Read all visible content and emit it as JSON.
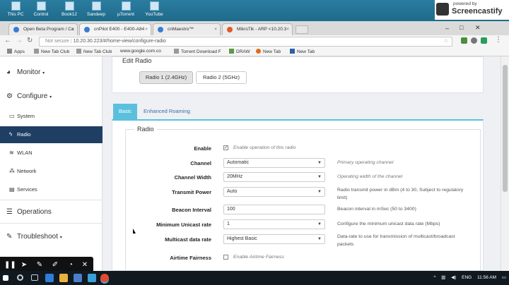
{
  "desktop": {
    "icons": [
      "This PC",
      "Control",
      "Book12",
      "Sandeep",
      "µTorrent",
      "YouTube"
    ],
    "watermark": {
      "powered_by": "powered by",
      "brand": "Screencastify"
    }
  },
  "browser": {
    "tabs": [
      {
        "label": "Open Beta Program / Ca",
        "active": false
      },
      {
        "label": "cnPilot E400 - E400-A84",
        "active": true
      },
      {
        "label": "cnMaestro™",
        "active": false
      },
      {
        "label": "MikroTik - ARP <10.20.3",
        "active": false
      }
    ],
    "security": "Not secure",
    "url": "10.20.30.223/#/home-view/configure-radio",
    "bookmarks": [
      "Apps",
      "New Tab Club",
      "New Tab Club",
      "www.google.com.co",
      "Torrent Download F",
      "DRAW",
      "New Tab",
      "New Tab"
    ]
  },
  "sidebar": {
    "monitor": "Monitor",
    "configure": "Configure",
    "items": [
      {
        "label": "System",
        "active": false
      },
      {
        "label": "Radio",
        "active": true
      },
      {
        "label": "WLAN",
        "active": false
      },
      {
        "label": "Network",
        "active": false
      },
      {
        "label": "Services",
        "active": false
      }
    ],
    "operations": "Operations",
    "troubleshoot": "Troubleshoot"
  },
  "edit_radio": {
    "title": "Edit Radio",
    "radio1": "Radio 1 (2.4GHz)",
    "radio2": "Radio 2 (5GHz)"
  },
  "page_tabs": {
    "basic": "Basic",
    "enhanced": "Enhanced Roaming"
  },
  "radio_section": {
    "legend": "Radio",
    "enable": {
      "label": "Enable",
      "text": "Enable operation of this radio",
      "checked": true
    },
    "channel": {
      "label": "Channel",
      "value": "Automatic",
      "help": "Primary operating channel"
    },
    "channel_width": {
      "label": "Channel Width",
      "value": "20MHz",
      "help": "Operating width of the channel"
    },
    "transmit_power": {
      "label": "Transmit Power",
      "value": "Auto",
      "help1": "Radio transmit power in dBm (4 to 30, Subject to regulatory",
      "help2": "limit)"
    },
    "beacon": {
      "label": "Beacon Interval",
      "value": "100",
      "help": "Beacon interval in mSec (50 to 3400)"
    },
    "unicast": {
      "label": "Minimum Unicast rate",
      "value": "1",
      "help": "Configure the minimum unicast data rate (Mbps)"
    },
    "multicast": {
      "label": "Multicast data rate",
      "value": "Highest Basic",
      "help1": "Data-rate to use for transmission of multicast/broadcast",
      "help2": "packets"
    },
    "airtime": {
      "label": "Airtime Fairness",
      "text": "Enable Airtime Fairness",
      "checked": false
    }
  },
  "taskbar": {
    "lang": "ENG",
    "time": "11:56 AM"
  },
  "colors": {
    "accent": "#5bc0de",
    "active_nav": "#1f3e63"
  }
}
